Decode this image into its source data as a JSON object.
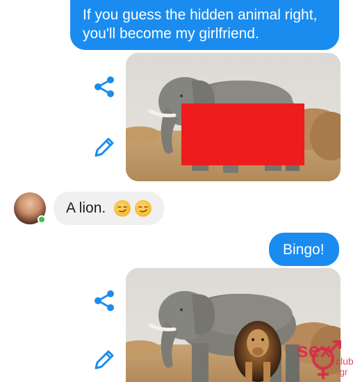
{
  "messages": {
    "outgoing_1": "If you guess the hidden animal right,\nyou'll become my girlfriend.",
    "incoming_1": "A lion.",
    "outgoing_2": "Bingo!"
  },
  "icons": {
    "share": "share-icon",
    "edit": "pencil-icon",
    "emoji": "smirking-face-emoji"
  },
  "colors": {
    "outgoing_bubble": "#1a8cf0",
    "incoming_bubble": "#f0f0f0",
    "icon_blue": "#1a8cf0",
    "censor_block": "#ee1c1c",
    "online_status": "#3cc43c"
  },
  "watermark": {
    "brand": "sex",
    "sub": "club",
    "tld": ".gr"
  }
}
